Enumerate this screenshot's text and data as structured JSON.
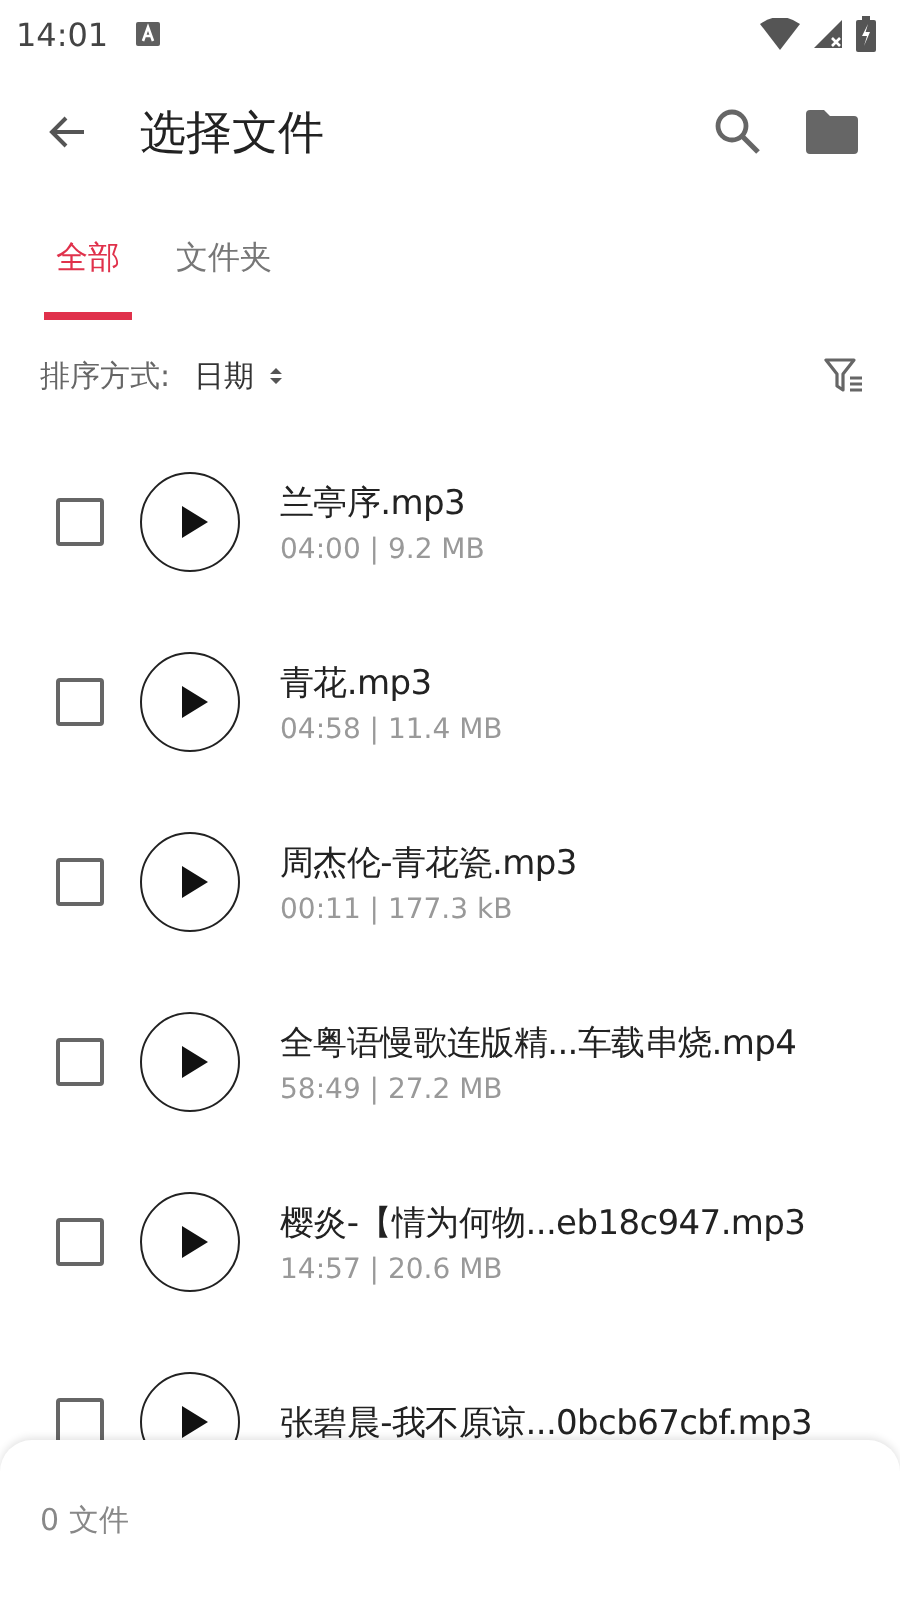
{
  "status_bar": {
    "time": "14:01"
  },
  "app_bar": {
    "title": "选择文件"
  },
  "tabs": [
    {
      "label": "全部",
      "selected": true
    },
    {
      "label": "文件夹",
      "selected": false
    }
  ],
  "sort": {
    "label": "排序方式:",
    "value": "日期"
  },
  "files": [
    {
      "name": "兰亭序.mp3",
      "meta": "04:00 | 9.2 MB",
      "checked": false
    },
    {
      "name": "青花.mp3",
      "meta": "04:58 | 11.4 MB",
      "checked": false
    },
    {
      "name": "周杰伦-青花瓷.mp3",
      "meta": "00:11 | 177.3 kB",
      "checked": false
    },
    {
      "name": "全粤语慢歌连版精...车载串烧.mp4",
      "meta": "58:49 | 27.2 MB",
      "checked": false
    },
    {
      "name": "樱炎-【情为何物...eb18c947.mp3",
      "meta": "14:57 | 20.6 MB",
      "checked": false
    },
    {
      "name": "张碧晨-我不原谅...0bcb67cbf.mp3",
      "checked": false
    }
  ],
  "bottom_bar": {
    "count": "0 文件"
  }
}
